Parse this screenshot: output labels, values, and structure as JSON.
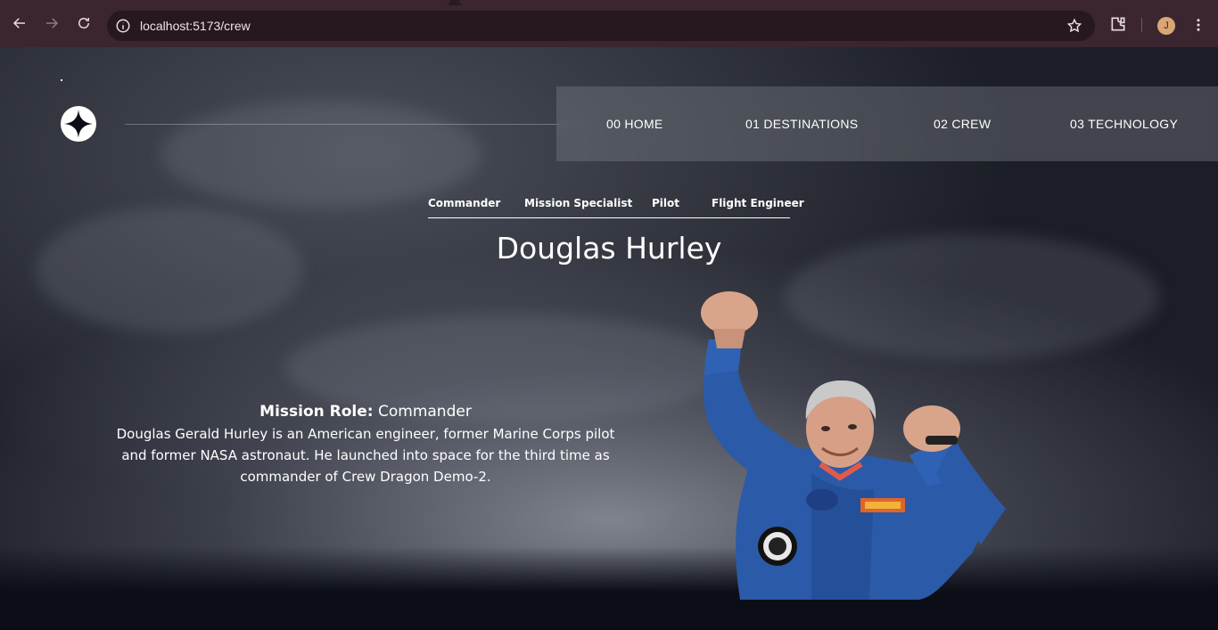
{
  "browser": {
    "url": "localhost:5173/crew",
    "profile_initial": "J"
  },
  "page": {
    "nav": [
      {
        "num": "00",
        "label": "HOME",
        "text": "00 HOME"
      },
      {
        "num": "01",
        "label": "DESTINATIONS",
        "text": "01 DESTINATIONS"
      },
      {
        "num": "02",
        "label": "CREW",
        "text": "02 CREW"
      },
      {
        "num": "03",
        "label": "TECHNOLOGY",
        "text": "03 TECHNOLOGY"
      }
    ],
    "crew_tabs": [
      "Commander",
      "Mission Specialist",
      "Pilot",
      "Flight Engineer"
    ],
    "active_tab": "Commander",
    "crew": {
      "name": "Douglas Hurley",
      "role_label": "Mission Role:",
      "role": "Commander",
      "bio": "Douglas Gerald Hurley is an American engineer, former Marine Corps pilot and former NASA astronaut. He launched into space for the third time as commander of Crew Dragon Demo-2."
    }
  },
  "colors": {
    "chrome": "#3a2530",
    "page_bg": "#0b0d17",
    "text": "#ffffff",
    "suit": "#2b5aa8"
  }
}
